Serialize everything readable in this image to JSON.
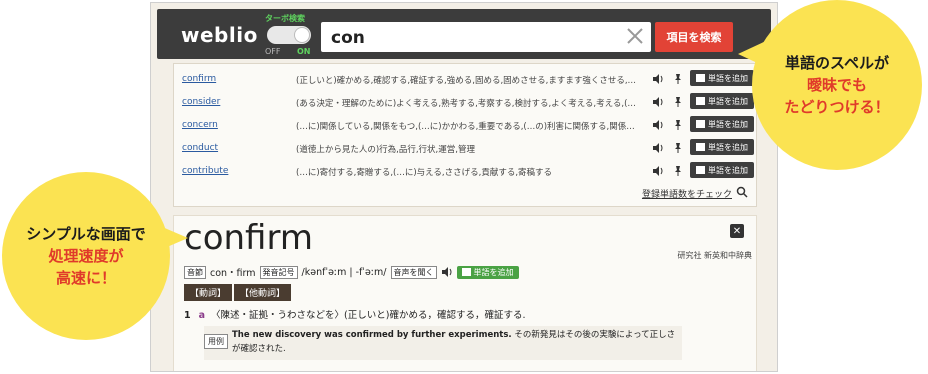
{
  "app": {
    "logo": "weblio",
    "turbo_label": "ターボ検索",
    "off_label": "OFF",
    "on_label": "ON",
    "search_value": "con",
    "search_button": "項目を検索"
  },
  "suggestions": [
    {
      "word": "confirm",
      "definition": "(正しいと)確かめる,確認する,確証する,強める,固める,固めさせる,ますます強くさせる,…",
      "add_label": "単語を追加"
    },
    {
      "word": "consider",
      "definition": "(ある決定・理解のために)よく考える,熟考する,考察する,検討する,よく考える,考える,(…",
      "add_label": "単語を追加"
    },
    {
      "word": "concern",
      "definition": "(…に)関係している,関係をもつ,(…に)かかわる,重要である,(…の)利害に関係する,関係…",
      "add_label": "単語を追加"
    },
    {
      "word": "conduct",
      "definition": "(道徳上から見た人の)行為,品行,行状,運営,管理",
      "add_label": "単語を追加"
    },
    {
      "word": "contribute",
      "definition": "(…に)寄付する,寄贈する,(…に)与える,ささげる,貢献する,寄稿する",
      "add_label": "単語を追加"
    }
  ],
  "check_link": "登録単語数をチェック",
  "entry": {
    "headword": "confirm",
    "dict_name": "研究社 新英和中辞典",
    "syllable_tag": "音節",
    "syllables": "con・firm",
    "pron_tag": "発音記号",
    "pron": "/kənfˈəːm | -fˈəːm/",
    "audio_tag": "音声を聞く",
    "add_label": "単語を追加",
    "pos": [
      "【動詞】",
      "【他動詞】"
    ],
    "sense_num": "1",
    "sense_letter": "a",
    "sense_text": "〈陳述・証拠・うわさなどを〉(正しいと)確かめる，確認する，確証する.",
    "example_tag": "用例",
    "example_en": "The new discovery was confirmed by further experiments.",
    "example_ja_1": "その新発見はその後の実験によって正しさ",
    "example_ja_2": "が確認された."
  },
  "callouts": {
    "right_line1": "単語のスペルが",
    "right_line2": "曖昧でも",
    "right_line3": "たどりつける！",
    "left_line1": "シンプルな画面で",
    "left_line2": "処理速度が",
    "left_line3": "高速に！"
  },
  "colors": {
    "header_bg": "#3c3c3c",
    "search_button": "#e24336",
    "bubble": "#fbe352",
    "accent_red": "#e03a2a",
    "green": "#4aa244"
  }
}
